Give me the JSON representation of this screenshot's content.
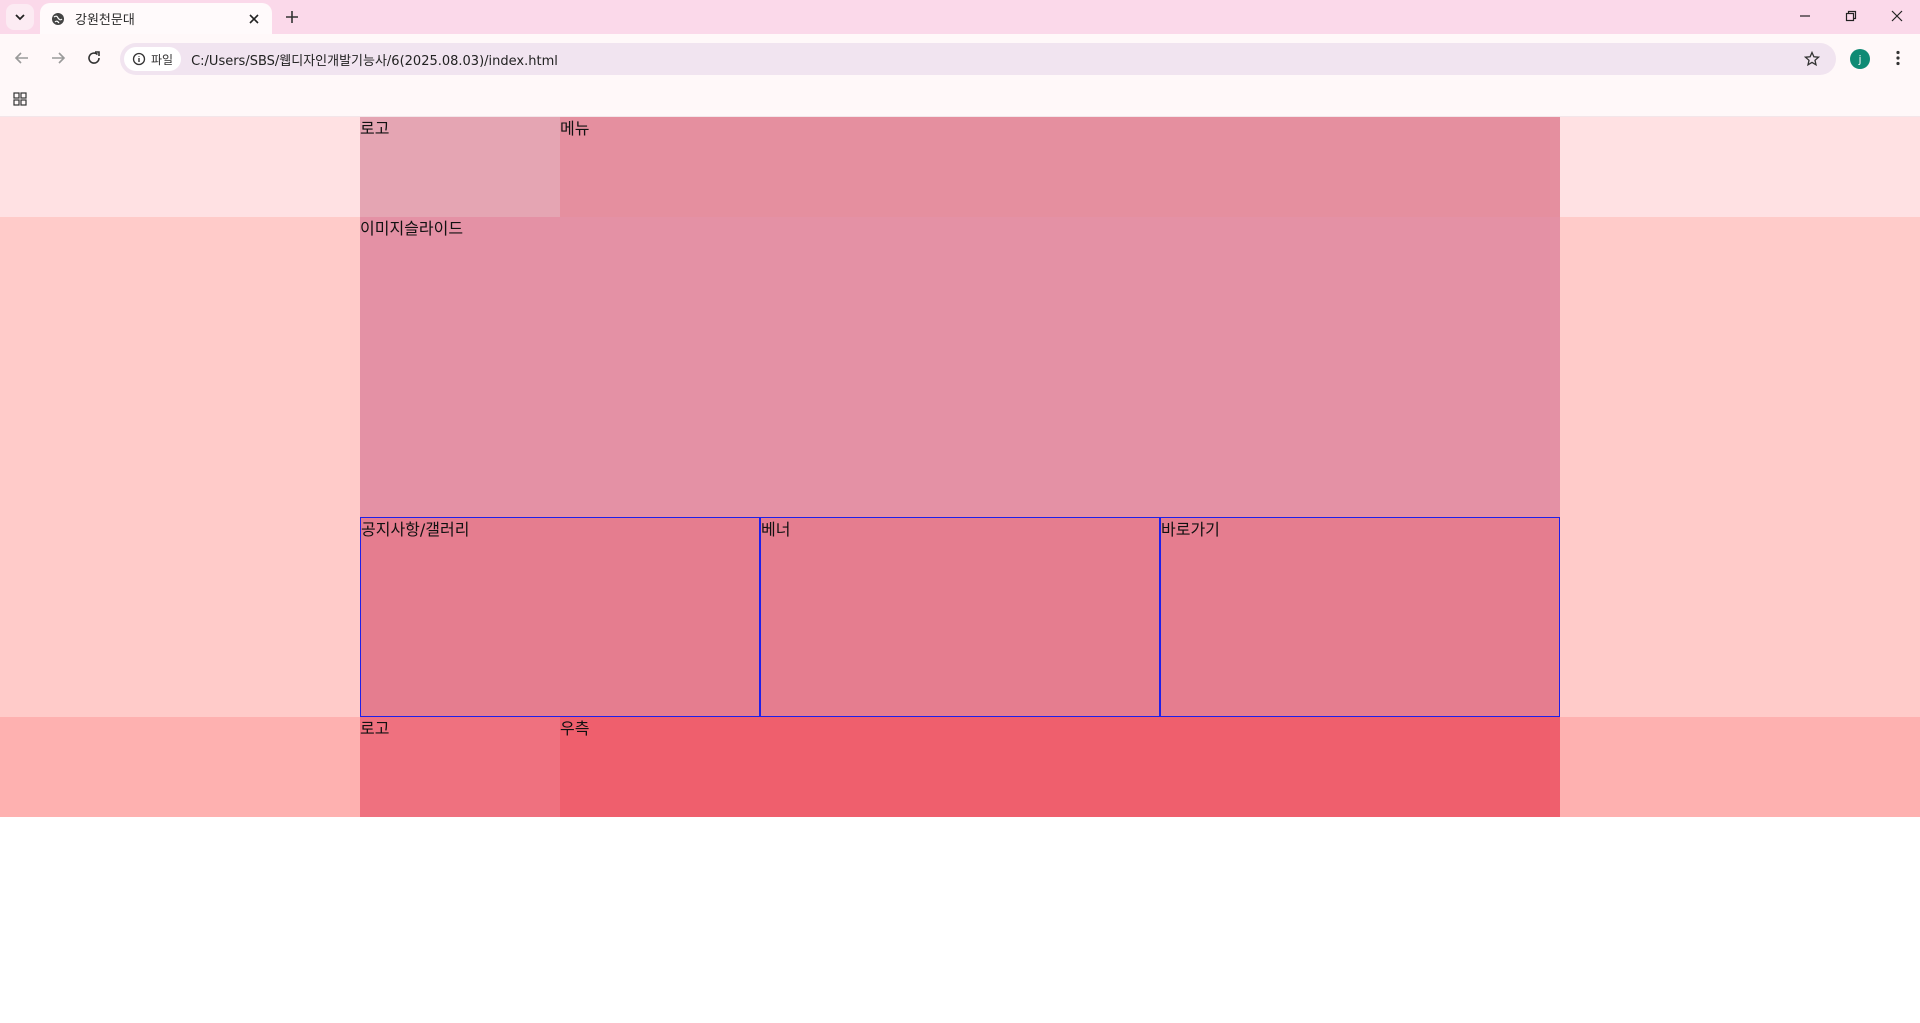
{
  "browser": {
    "tab_title": "강원천문대",
    "chip_label": "파일",
    "url": "C:/Users/SBS/웹디자인개발기능사/6(2025.08.03)/index.html",
    "profile_initial": "j",
    "icons": [
      "tab-search-icon",
      "globe-icon",
      "close-icon",
      "plus-icon",
      "minimize-icon",
      "restore-icon",
      "window-close-icon",
      "back-arrow-icon",
      "forward-arrow-icon",
      "reload-icon",
      "info-icon",
      "star-icon",
      "more-vert-icon",
      "apps-grid-icon"
    ]
  },
  "page": {
    "header": {
      "logo": "로고",
      "menu": "메뉴"
    },
    "slide": {
      "label": "이미지슬라이드"
    },
    "content": {
      "notice": "공지사항/갤러리",
      "banner": "베너",
      "shortcut": "바로가기"
    },
    "footer": {
      "logo": "로고",
      "right": "우측"
    }
  },
  "colors": {
    "header_bg": "#ffe1e3",
    "header_logo": "#e5a5b3",
    "header_menu": "#e58f9f",
    "slide_bg": "#ffcbc9",
    "slide": "#e491a5",
    "content_bg": "#ffcbc9",
    "content_box": "#e57d8f",
    "content_border": "#1f1fe8",
    "footer_bg": "#feb1b0",
    "footer_logo": "#ef717f",
    "footer_right": "#ef5f6d"
  }
}
